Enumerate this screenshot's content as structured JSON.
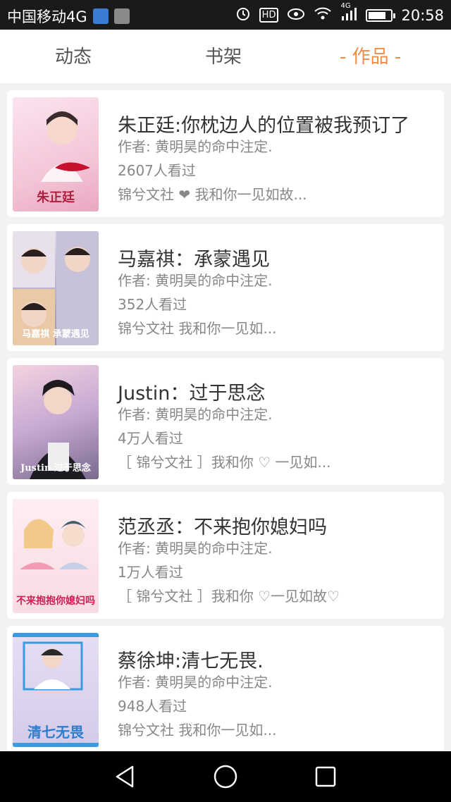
{
  "status_bar": {
    "carrier": "中国移动4G",
    "network": "4G",
    "time": "20:58",
    "hd": "HD"
  },
  "tabs": [
    {
      "label": "动态",
      "active": false
    },
    {
      "label": "书架",
      "active": false
    },
    {
      "label": "- 作品 -",
      "active": true
    }
  ],
  "accent_color": "#f08c4a",
  "books": [
    {
      "title": "朱正廷:你枕边人的位置被我预订了",
      "author": "作者: 黄明昊的命中注定.",
      "views": "2607人看过",
      "tags": "锦兮文社 ❤ 我和你一见如故..."
    },
    {
      "title": "马嘉祺：承蒙遇见",
      "author": "作者: 黄明昊的命中注定.",
      "views": "352人看过",
      "tags": "锦兮文社  我和你一见如..."
    },
    {
      "title": "Justin：过于思念",
      "author": "作者: 黄明昊的命中注定.",
      "views": "4万人看过",
      "tags": "［ 锦兮文社 ］我和你 ♡  一见如..."
    },
    {
      "title": "范丞丞：不来抱你媳妇吗",
      "author": "作者: 黄明昊的命中注定.",
      "views": "1万人看过",
      "tags": "［ 锦兮文社 ］我和你   ♡一见如故♡"
    },
    {
      "title": "蔡徐坤:清七无畏.",
      "author": "作者: 黄明昊的命中注定.",
      "views": "948人看过",
      "tags": "锦兮文社  我和你一见如..."
    }
  ],
  "cover_captions": [
    "朱正廷",
    "马嘉祺 承蒙遇见",
    "Justin 过于思念",
    "不来抱抱你媳妇吗",
    "清七无畏"
  ]
}
